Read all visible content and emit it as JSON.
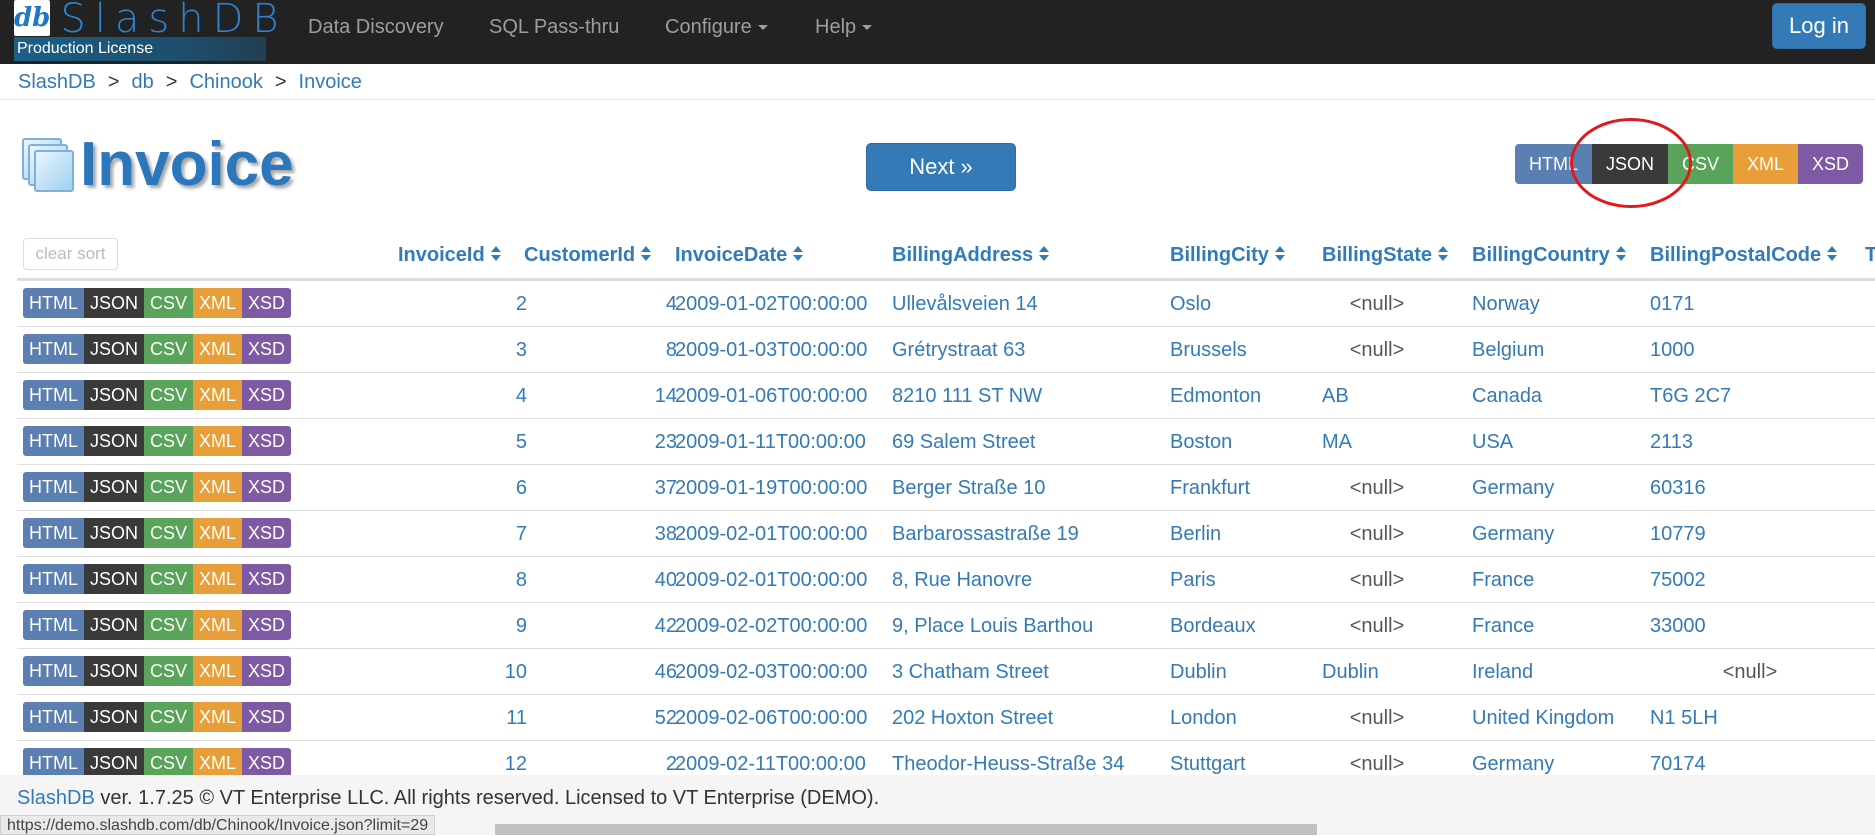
{
  "brand": {
    "mark": "db",
    "name": "SlashDB",
    "license": "Production License"
  },
  "nav": {
    "items": [
      {
        "label": "Data Discovery"
      },
      {
        "label": "SQL Pass-thru"
      },
      {
        "label": "Configure"
      },
      {
        "label": "Help"
      }
    ],
    "login_label": "Log in"
  },
  "breadcrumb": [
    "SlashDB",
    "db",
    "Chinook",
    "Invoice"
  ],
  "breadcrumb_sep": ">",
  "page": {
    "title": "Invoice",
    "next_label": "Next »"
  },
  "formats": [
    "HTML",
    "JSON",
    "CSV",
    "XML",
    "XSD"
  ],
  "table": {
    "clear_sort_label": "clear sort",
    "columns": [
      "InvoiceId",
      "CustomerId",
      "InvoiceDate",
      "BillingAddress",
      "BillingCity",
      "BillingState",
      "BillingCountry",
      "BillingPostalCode",
      "T"
    ],
    "rows": [
      {
        "id": "2",
        "customer": "4",
        "date": "2009-01-02T00:00:00",
        "address": "Ullevålsveien 14",
        "city": "Oslo",
        "state": "<null>",
        "country": "Norway",
        "postal": "0171"
      },
      {
        "id": "3",
        "customer": "8",
        "date": "2009-01-03T00:00:00",
        "address": "Grétrystraat 63",
        "city": "Brussels",
        "state": "<null>",
        "country": "Belgium",
        "postal": "1000"
      },
      {
        "id": "4",
        "customer": "14",
        "date": "2009-01-06T00:00:00",
        "address": "8210 111 ST NW",
        "city": "Edmonton",
        "state": "AB",
        "country": "Canada",
        "postal": "T6G 2C7"
      },
      {
        "id": "5",
        "customer": "23",
        "date": "2009-01-11T00:00:00",
        "address": "69 Salem Street",
        "city": "Boston",
        "state": "MA",
        "country": "USA",
        "postal": "2113"
      },
      {
        "id": "6",
        "customer": "37",
        "date": "2009-01-19T00:00:00",
        "address": "Berger Straße 10",
        "city": "Frankfurt",
        "state": "<null>",
        "country": "Germany",
        "postal": "60316"
      },
      {
        "id": "7",
        "customer": "38",
        "date": "2009-02-01T00:00:00",
        "address": "Barbarossastraße 19",
        "city": "Berlin",
        "state": "<null>",
        "country": "Germany",
        "postal": "10779"
      },
      {
        "id": "8",
        "customer": "40",
        "date": "2009-02-01T00:00:00",
        "address": "8, Rue Hanovre",
        "city": "Paris",
        "state": "<null>",
        "country": "France",
        "postal": "75002"
      },
      {
        "id": "9",
        "customer": "42",
        "date": "2009-02-02T00:00:00",
        "address": "9, Place Louis Barthou",
        "city": "Bordeaux",
        "state": "<null>",
        "country": "France",
        "postal": "33000"
      },
      {
        "id": "10",
        "customer": "46",
        "date": "2009-02-03T00:00:00",
        "address": "3 Chatham Street",
        "city": "Dublin",
        "state": "Dublin",
        "country": "Ireland",
        "postal": "<null>"
      },
      {
        "id": "11",
        "customer": "52",
        "date": "2009-02-06T00:00:00",
        "address": "202 Hoxton Street",
        "city": "London",
        "state": "<null>",
        "country": "United Kingdom",
        "postal": "N1 5LH"
      },
      {
        "id": "12",
        "customer": "2",
        "date": "2009-02-11T00:00:00",
        "address": "Theodor-Heuss-Straße 34",
        "city": "Stuttgart",
        "state": "<null>",
        "country": "Germany",
        "postal": "70174"
      }
    ]
  },
  "footer": {
    "link": "SlashDB",
    "text": " ver. 1.7.25 © VT Enterprise LLC. All rights reserved. Licensed to VT Enterprise (DEMO)."
  },
  "status_url": "https://demo.slashdb.com/db/Chinook/Invoice.json?limit=29",
  "colors": {
    "accent": "#337ab7",
    "html": "#5b7fb0",
    "json": "#3a3a3a",
    "csv": "#5aa35a",
    "xml": "#e89f3a",
    "xsd": "#7d5aa3",
    "highlight": "#e0191b"
  }
}
